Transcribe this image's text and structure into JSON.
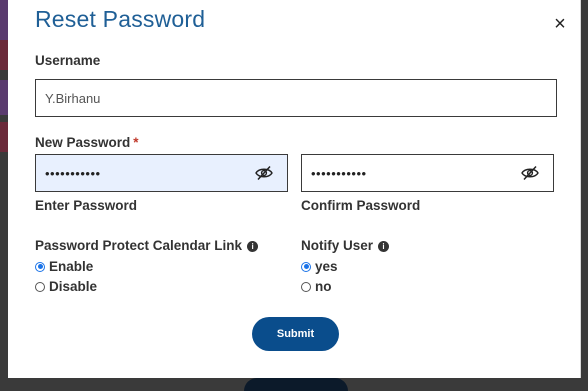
{
  "modal": {
    "title": "Reset Password",
    "close_label": "×"
  },
  "username": {
    "label": "Username",
    "value": "Y.Birhanu"
  },
  "new_password": {
    "label": "New Password",
    "required_mark": "*",
    "enter_value": "•••••••••••",
    "enter_caption": "Enter Password",
    "confirm_value": "•••••••••••",
    "confirm_caption": "Confirm Password"
  },
  "calendar_protect": {
    "label": "Password Protect Calendar Link",
    "info_icon": "info-icon",
    "options": [
      {
        "label": "Enable",
        "checked": true
      },
      {
        "label": "Disable",
        "checked": false
      }
    ]
  },
  "notify_user": {
    "label": "Notify User",
    "info_icon": "info-icon",
    "options": [
      {
        "label": "yes",
        "checked": true
      },
      {
        "label": "no",
        "checked": false
      }
    ]
  },
  "submit_label": "Submit",
  "colors": {
    "title": "#1f5f96",
    "submit_bg": "#0a4d8c",
    "active_field_bg": "#e8f0fe",
    "required": "#c0392b"
  }
}
